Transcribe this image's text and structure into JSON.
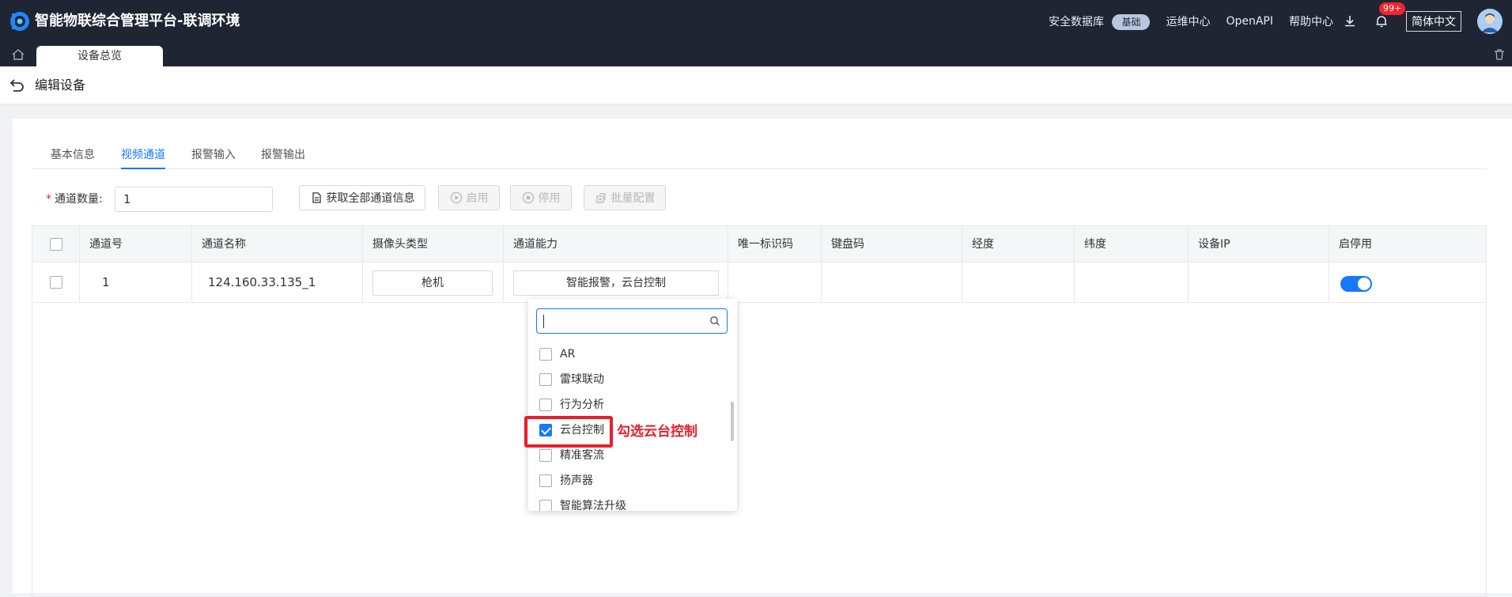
{
  "topbar": {
    "app_title": "智能物联综合管理平台-联调环境",
    "security_db_label": "安全数据库",
    "security_db_badge": "基础",
    "ops_center": "运维中心",
    "open_api": "OpenAPI",
    "help_center": "帮助中心",
    "notification_count": "99+",
    "language": "简体中文"
  },
  "tabbar": {
    "active_tab": "设备总览"
  },
  "page": {
    "title": "编辑设备"
  },
  "tabs": [
    {
      "label": "基本信息",
      "active": false
    },
    {
      "label": "视频通道",
      "active": true
    },
    {
      "label": "报警输入",
      "active": false
    },
    {
      "label": "报警输出",
      "active": false
    }
  ],
  "toolbar": {
    "channel_count_label": "通道数量:",
    "channel_count_value": "1",
    "fetch_all_label": "获取全部通道信息",
    "enable_label": "启用",
    "disable_label": "停用",
    "batch_config_label": "批量配置"
  },
  "table": {
    "headers": [
      "通道号",
      "通道名称",
      "摄像头类型",
      "通道能力",
      "唯一标识码",
      "键盘码",
      "经度",
      "纬度",
      "设备IP",
      "启停用"
    ],
    "rows": [
      {
        "channel_no": "1",
        "channel_name": "124.160.33.135_1",
        "camera_type": "枪机",
        "capability": "智能报警，云台控制",
        "unique_id": "",
        "keyboard_code": "",
        "longitude": "",
        "latitude": "",
        "device_ip": "",
        "enabled": true
      }
    ]
  },
  "dropdown": {
    "search_value": "",
    "options": [
      {
        "label": "AR",
        "checked": false
      },
      {
        "label": "雷球联动",
        "checked": false
      },
      {
        "label": "行为分析",
        "checked": false
      },
      {
        "label": "云台控制",
        "checked": true
      },
      {
        "label": "精准客流",
        "checked": false
      },
      {
        "label": "扬声器",
        "checked": false
      },
      {
        "label": "智能算法升级",
        "checked": false
      }
    ]
  },
  "annotation": {
    "text": "勾选云台控制"
  },
  "colors": {
    "topbar": "#1f2533",
    "accent": "#1677ff",
    "annotation": "#e81e2b"
  }
}
